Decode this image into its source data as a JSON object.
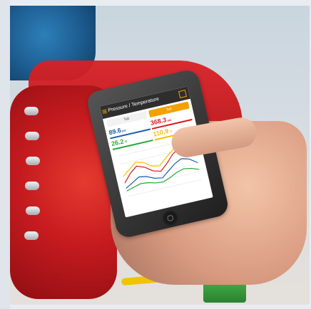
{
  "image": {
    "alt": "Hand holding a smartphone showing pressure and temperature readings in front of industrial red pipes"
  },
  "phone": {
    "app_title": "Pressure / Temperature",
    "tabs": [
      {
        "label": "Tab"
      },
      {
        "label": "Tab"
      }
    ],
    "readings": [
      {
        "value": "89.6",
        "unit": "psi"
      },
      {
        "value": "368.3",
        "unit": "psi"
      },
      {
        "value": "26.2",
        "unit": "°F"
      },
      {
        "value": "110.9",
        "unit": "°F"
      }
    ]
  },
  "chart_data": {
    "type": "line",
    "series": [
      {
        "values": [
          20,
          32,
          40,
          36,
          28,
          25,
          34,
          45,
          52,
          48,
          38
        ]
      },
      {
        "values": [
          12,
          18,
          24,
          22,
          17,
          15,
          23,
          31,
          36,
          33,
          25
        ]
      },
      {
        "values": [
          8,
          11,
          14,
          13,
          10,
          9,
          13,
          18,
          21,
          19,
          15
        ]
      },
      {
        "values": [
          30,
          38,
          46,
          43,
          35,
          33,
          42,
          50,
          58,
          54,
          45
        ]
      }
    ],
    "colors": [
      "#d61b1f",
      "#1c5ea8",
      "#2aa638",
      "#f2c200"
    ],
    "ylim": [
      0,
      60
    ]
  }
}
